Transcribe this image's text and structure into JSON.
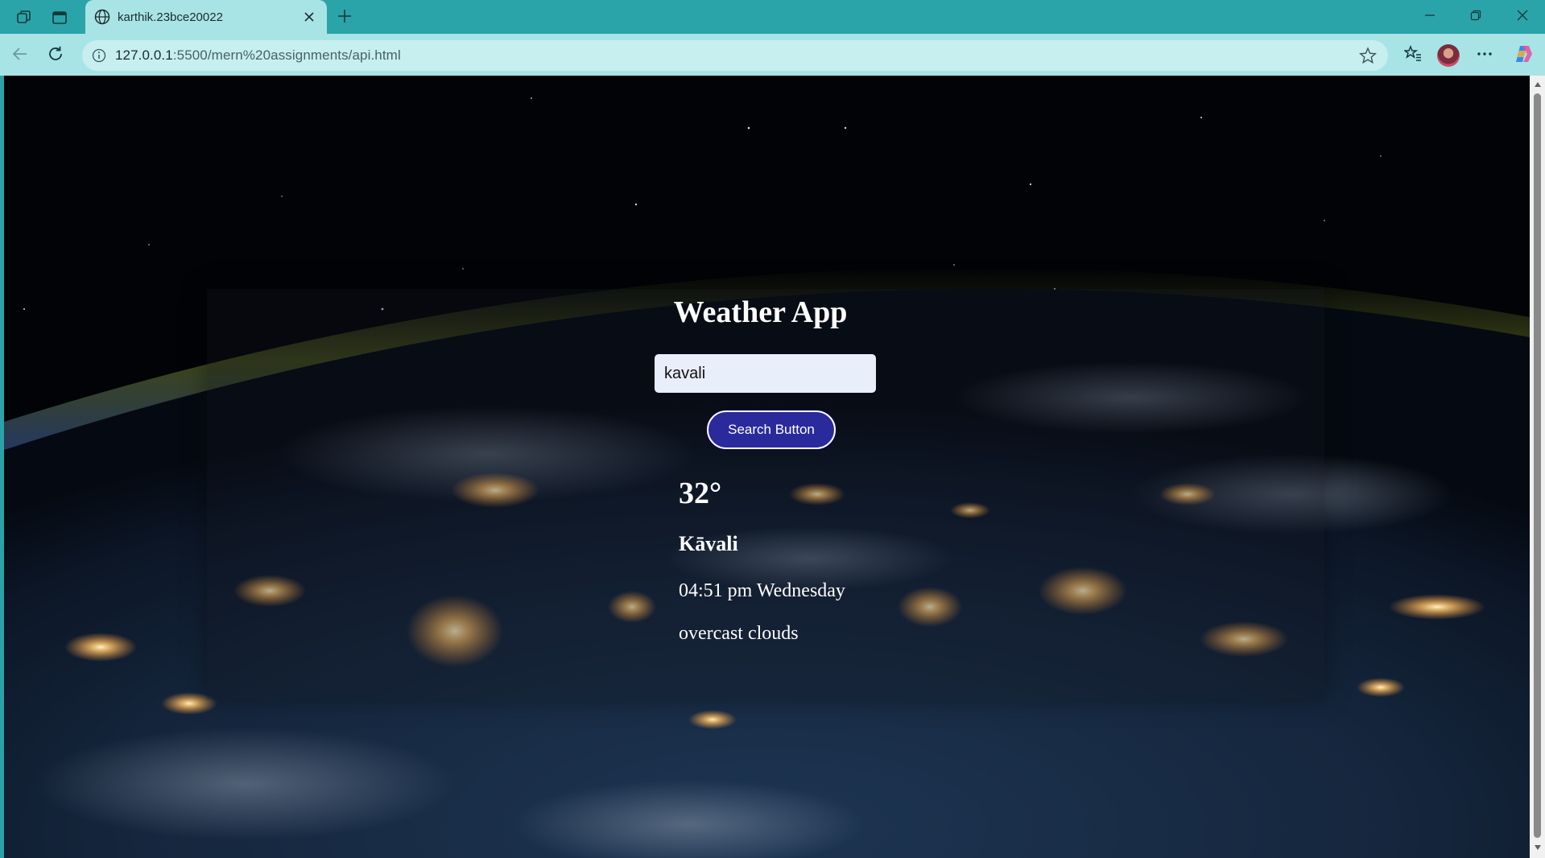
{
  "browser": {
    "tab_title": "karthik.23bce20022",
    "url_host": "127.0.0.1",
    "url_rest": ":5500/mern%20assignments/api.html",
    "icons": {
      "workspaces": "workspaces-icon",
      "tab_actions": "tab-actions-icon",
      "globe": "globe-icon",
      "close_tab": "close-icon",
      "new_tab": "plus-icon",
      "minimize": "minimize-icon",
      "restore": "restore-icon",
      "close_window": "close-icon",
      "back": "back-arrow-icon",
      "refresh": "refresh-icon",
      "site_info": "info-icon",
      "favorite": "star-icon",
      "favorites_bar": "favorites-icon",
      "profile": "avatar",
      "more": "more-icon",
      "copilot": "copilot-icon"
    }
  },
  "app": {
    "title": "Weather App",
    "search_value": "kavali",
    "search_button_label": "Search Button",
    "temperature": "32°",
    "city": "Kāvali",
    "datetime": "04:51 pm Wednesday",
    "description": "overcast clouds"
  },
  "colors": {
    "chrome_teal": "#2ba4a9",
    "toolbar": "#a8e4e6",
    "button_bg": "#2a2a9c",
    "input_bg": "#e9eefb"
  }
}
